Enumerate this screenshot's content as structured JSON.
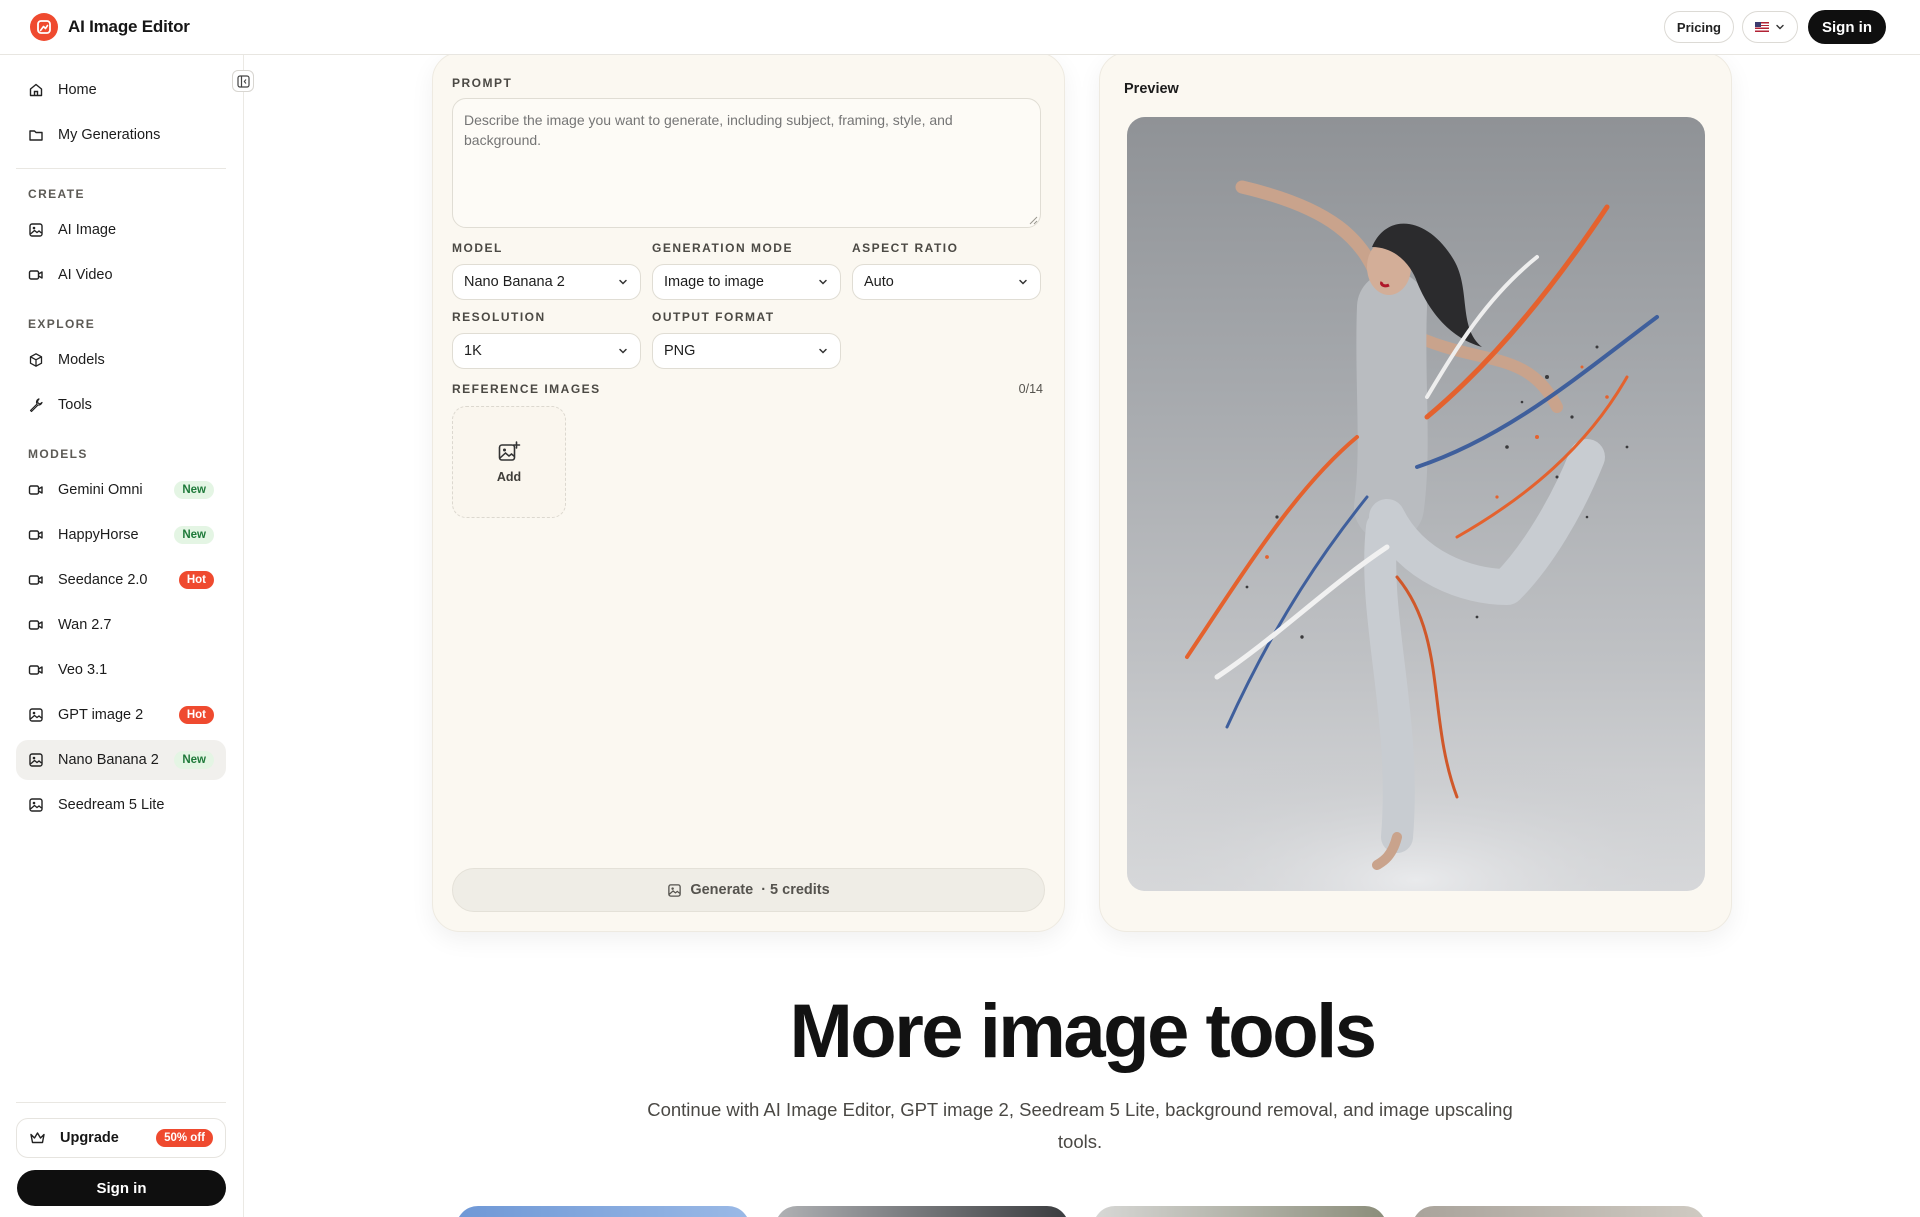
{
  "header": {
    "brand": "AI Image Editor",
    "pricing": "Pricing",
    "sign_in": "Sign in"
  },
  "sidebar": {
    "top_items": [
      {
        "label": "Home",
        "icon": "home-icon"
      },
      {
        "label": "My Generations",
        "icon": "folder-icon"
      }
    ],
    "sections": {
      "create": "CREATE",
      "explore": "EXPLORE",
      "models": "MODELS"
    },
    "create_items": [
      {
        "label": "AI Image",
        "icon": "image-icon"
      },
      {
        "label": "AI Video",
        "icon": "video-icon"
      }
    ],
    "explore_items": [
      {
        "label": "Models",
        "icon": "cube-icon"
      },
      {
        "label": "Tools",
        "icon": "wrench-icon"
      }
    ],
    "model_items": [
      {
        "label": "Gemini Omni",
        "badge": "New",
        "icon": "video-icon"
      },
      {
        "label": "HappyHorse",
        "badge": "New",
        "icon": "video-icon"
      },
      {
        "label": "Seedance 2.0",
        "badge": "Hot",
        "icon": "video-icon"
      },
      {
        "label": "Wan 2.7",
        "badge": "",
        "icon": "video-icon"
      },
      {
        "label": "Veo 3.1",
        "badge": "",
        "icon": "video-icon"
      },
      {
        "label": "GPT image 2",
        "badge": "Hot",
        "icon": "image-icon"
      },
      {
        "label": "Nano Banana 2",
        "badge": "New",
        "icon": "image-icon",
        "active": true
      },
      {
        "label": "Seedream 5 Lite",
        "badge": "",
        "icon": "image-icon"
      }
    ],
    "upgrade": {
      "label": "Upgrade",
      "badge": "50% off"
    },
    "sign_in": "Sign in"
  },
  "form": {
    "prompt_label": "PROMPT",
    "prompt_placeholder": "Describe the image you want to generate, including subject, framing, style, and background.",
    "model_label": "MODEL",
    "model_value": "Nano Banana 2",
    "mode_label": "GENERATION MODE",
    "mode_value": "Image to image",
    "aspect_label": "ASPECT RATIO",
    "aspect_value": "Auto",
    "resolution_label": "RESOLUTION",
    "resolution_value": "1K",
    "format_label": "OUTPUT FORMAT",
    "format_value": "PNG",
    "reference_label": "REFERENCE IMAGES",
    "reference_count": "0/14",
    "add_label": "Add",
    "generate_label": "Generate",
    "generate_credits": "· 5 credits"
  },
  "preview": {
    "title": "Preview"
  },
  "section": {
    "headline": "More image tools",
    "subline": "Continue with AI Image Editor, GPT image 2, Seedream 5 Lite, background removal, and image upscaling tools."
  },
  "colors": {
    "accent": "#ef4a2f",
    "panel_bg": "#fbf8f1",
    "new_badge_bg": "#e4f5e4",
    "new_badge_text": "#1f7a3a"
  }
}
